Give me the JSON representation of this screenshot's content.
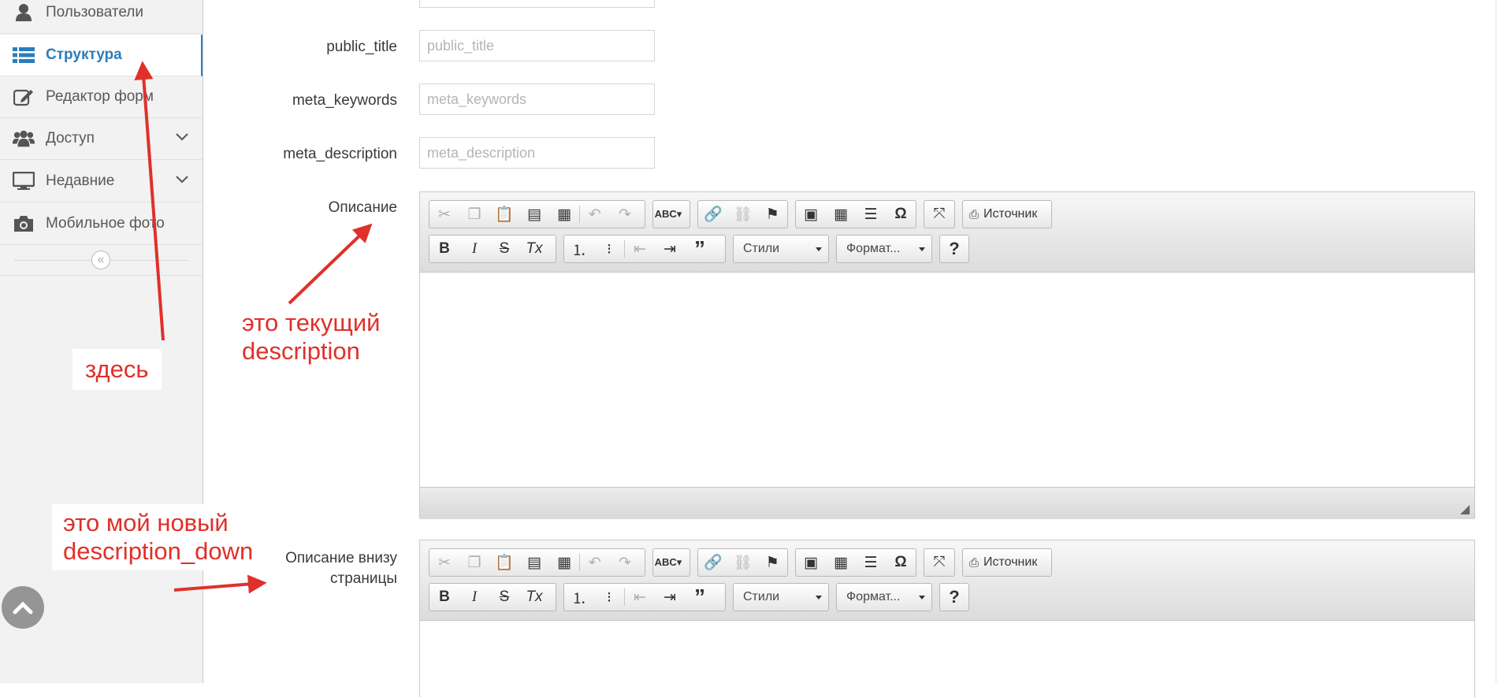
{
  "sidebar": {
    "items": [
      {
        "label": "Пользователи",
        "icon": "user-icon"
      },
      {
        "label": "Структура",
        "icon": "list-icon",
        "active": true
      },
      {
        "label": "Редактор форм",
        "icon": "edit-icon"
      },
      {
        "label": "Доступ",
        "icon": "users-group-icon",
        "has_submenu": true
      },
      {
        "label": "Недавние",
        "icon": "monitor-icon",
        "has_submenu": true
      },
      {
        "label": "Мобильное фото",
        "icon": "camera-icon"
      }
    ],
    "collapse_glyph": "«"
  },
  "form": {
    "fields": [
      {
        "label": "public_title",
        "placeholder": "public_title",
        "value": ""
      },
      {
        "label": "meta_keywords",
        "placeholder": "meta_keywords",
        "value": ""
      },
      {
        "label": "meta_description",
        "placeholder": "meta_description",
        "value": ""
      }
    ],
    "editors": [
      {
        "label": "Описание"
      },
      {
        "label_line1": "Описание внизу",
        "label_line2": "страницы"
      }
    ]
  },
  "toolbar": {
    "source_label": "Источник",
    "styles_label": "Стили",
    "format_label": "Формат...",
    "help_label": "?",
    "bold_label": "B",
    "italic_label": "I",
    "strike_label": "S",
    "omega_label": "Ω"
  },
  "annotations": {
    "here": "здесь",
    "current_line1": "это текущий",
    "current_line2": "description",
    "new_line1": "это мой новый",
    "new_line2": "description_down"
  },
  "colors": {
    "accent": "#2b7dbc",
    "annotation": "#e0302a",
    "sidebar_bg": "#f2f2f2"
  }
}
